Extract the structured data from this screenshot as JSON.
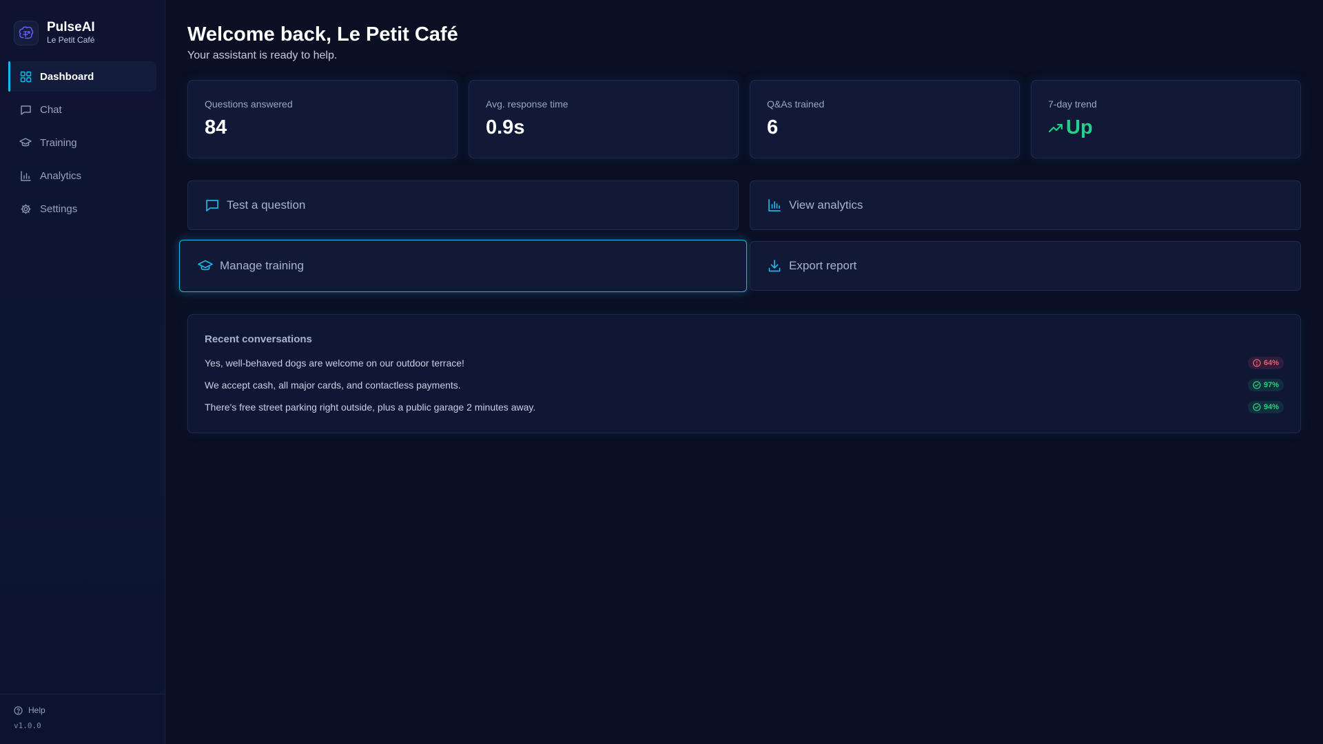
{
  "brand": {
    "name": "PulseAI",
    "business": "Le Petit Café"
  },
  "nav": {
    "items": [
      {
        "label": "Dashboard",
        "icon": "grid-icon",
        "active": true
      },
      {
        "label": "Chat",
        "icon": "chat-icon"
      },
      {
        "label": "Training",
        "icon": "graduation-cap-icon"
      },
      {
        "label": "Analytics",
        "icon": "bar-chart-icon"
      },
      {
        "label": "Settings",
        "icon": "gear-icon"
      }
    ]
  },
  "footer": {
    "help": "Help",
    "version": "v1.0.0"
  },
  "header": {
    "title": "Welcome back, Le Petit Café",
    "subtitle": "Your assistant is ready to help."
  },
  "stats": [
    {
      "label": "Questions answered",
      "value": "84"
    },
    {
      "label": "Avg. response time",
      "value": "0.9s"
    },
    {
      "label": "Q&As trained",
      "value": "6"
    },
    {
      "label": "7-day trend",
      "value": "Up",
      "icon": "trending-up-icon",
      "color": "#1ed38a"
    }
  ],
  "actions": [
    {
      "label": "Test a question",
      "icon": "chat-icon"
    },
    {
      "label": "View analytics",
      "icon": "bar-chart-icon"
    },
    {
      "label": "Manage training",
      "icon": "graduation-cap-icon",
      "focused": true
    },
    {
      "label": "Export report",
      "icon": "download-icon"
    }
  ],
  "recent": {
    "title": "Recent conversations",
    "items": [
      {
        "text": "Yes, well-behaved dogs are welcome on our outdoor terrace!",
        "score": "64%",
        "status": "low"
      },
      {
        "text": "We accept cash, all major cards, and contactless payments.",
        "score": "97%",
        "status": "high"
      },
      {
        "text": "There's free street parking right outside, plus a public garage 2 minutes away.",
        "score": "94%",
        "status": "high"
      }
    ]
  },
  "colors": {
    "accent": "#1ab8e8",
    "success": "#1ed38a",
    "warning": "#ef5b73",
    "background": "#0a0f24"
  }
}
